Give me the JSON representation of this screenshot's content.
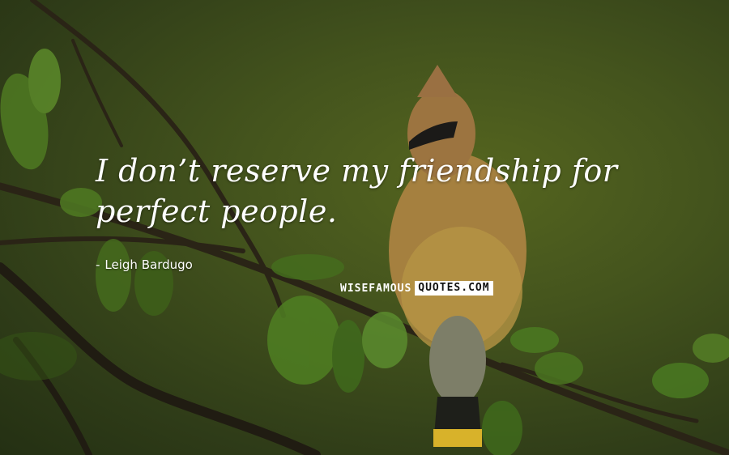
{
  "quote": {
    "text": "I don’t reserve my friendship for perfect people.",
    "author": "Leigh Bardugo",
    "author_dash": "-"
  },
  "watermark": {
    "part1": "WISEFAMOUS",
    "part2": "QUOTES.COM",
    "text_color": "#ffffff",
    "box_color": "#ffffff"
  },
  "photo": {
    "subject": "cedar waxwing bird perched on a leafy branch",
    "background_color": "#3f4e1c"
  }
}
